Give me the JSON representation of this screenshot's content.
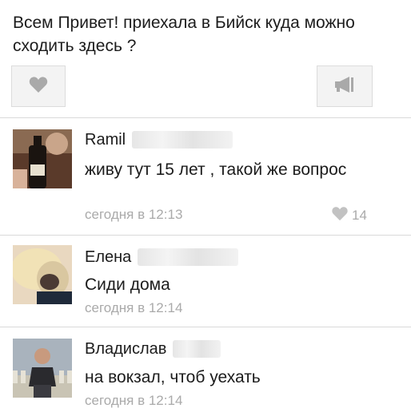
{
  "post": {
    "text": "Всем Привет! приехала в Бийск куда можно сходить здесь ?"
  },
  "actions": {
    "like_icon": "heart-icon",
    "share_icon": "megaphone-icon"
  },
  "comments": [
    {
      "author": "Ramil",
      "text": "живу тут 15 лет , такой же вопрос",
      "time": "сегодня в 12:13",
      "likes": "14"
    },
    {
      "author": "Елена",
      "text": "Сиди дома",
      "time": "сегодня в 12:14"
    },
    {
      "author": "Владислав",
      "text": "на вокзал, чтоб уехать",
      "time": "сегодня в 12:14"
    }
  ],
  "colors": {
    "meta": "#aaaaaa",
    "divider": "#d9d9d9",
    "button_bg": "#f3f3f3"
  }
}
